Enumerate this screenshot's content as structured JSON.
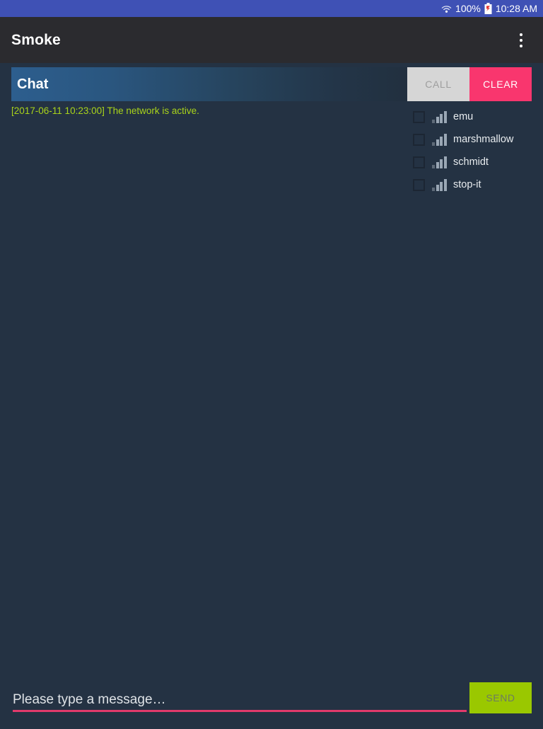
{
  "status_bar": {
    "wifi_icon": "wifi-icon",
    "battery_percent": "100%",
    "battery_icon": "battery-unknown-icon",
    "time": "10:28 AM",
    "background_color": "#3f51b5"
  },
  "app_bar": {
    "title": "Smoke",
    "overflow_icon": "overflow-menu-icon",
    "background_color": "#2b2b2f"
  },
  "chat_panel": {
    "header_label": "Chat",
    "header_gradient_start": "#2d5e8e",
    "header_gradient_end": "#22303f",
    "call_label": "CALL",
    "call_color": "#d6d6d6",
    "clear_label": "CLEAR",
    "clear_color": "#f9366e",
    "status_message": "[2017-06-11 10:23:00] The network is active.",
    "status_color": "#a9d31a"
  },
  "participants": {
    "signal_icon": "signal-bars-icon",
    "items": [
      {
        "name": "emu",
        "checked": false
      },
      {
        "name": "marshmallow",
        "checked": false
      },
      {
        "name": "schmidt",
        "checked": false
      },
      {
        "name": "stop-it",
        "checked": false
      }
    ]
  },
  "message_bar": {
    "input_value": "",
    "input_placeholder": "Please type a message…",
    "underline_color": "#e23a6b",
    "send_label": "SEND",
    "send_color": "#9ac800"
  },
  "theme": {
    "background": "#243243"
  }
}
